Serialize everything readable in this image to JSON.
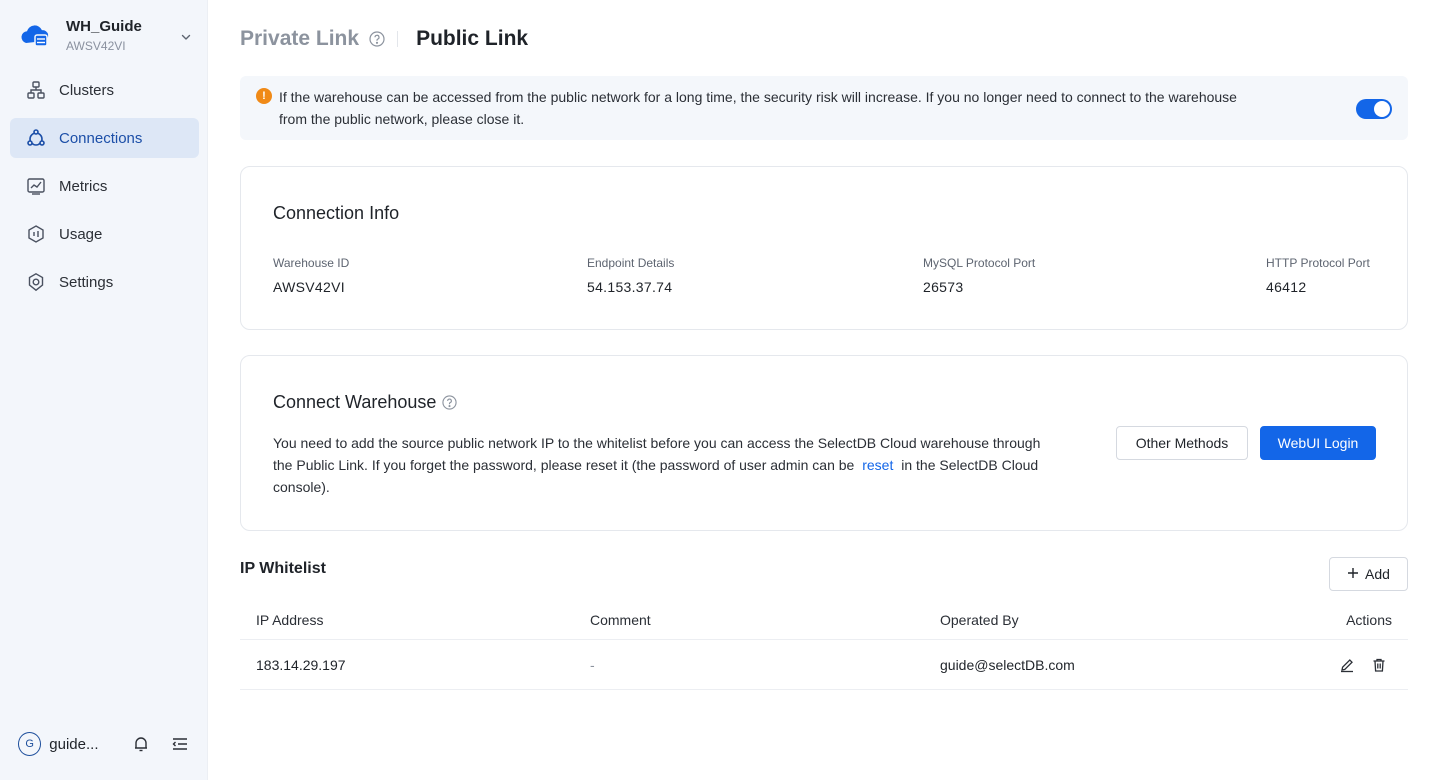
{
  "workspace": {
    "name": "WH_Guide",
    "id": "AWSV42VI",
    "logo_icon": "cloud-database-icon"
  },
  "sidebar": {
    "items": [
      {
        "label": "Clusters",
        "icon": "cluster-icon",
        "active": false
      },
      {
        "label": "Connections",
        "icon": "connections-icon",
        "active": true
      },
      {
        "label": "Metrics",
        "icon": "metrics-icon",
        "active": false
      },
      {
        "label": "Usage",
        "icon": "usage-icon",
        "active": false
      },
      {
        "label": "Settings",
        "icon": "settings-icon",
        "active": false
      }
    ],
    "footer": {
      "avatar_letter": "G",
      "user_name": "guide..."
    }
  },
  "tabs": {
    "private": "Private Link",
    "public": "Public Link"
  },
  "alert": {
    "icon_text": "!",
    "text": "If the warehouse can be accessed from the public network for a long time, the security risk will increase. If you no longer need to connect to the warehouse from the public network, please close it.",
    "toggle_on": true
  },
  "connection_info": {
    "title": "Connection Info",
    "fields": [
      {
        "label": "Warehouse ID",
        "value": "AWSV42VI"
      },
      {
        "label": "Endpoint Details",
        "value": "54.153.37.74"
      },
      {
        "label": "MySQL Protocol Port",
        "value": "26573"
      },
      {
        "label": "HTTP Protocol Port",
        "value": "46412"
      }
    ]
  },
  "connect_warehouse": {
    "title": "Connect Warehouse",
    "text_before": "You need to add the source public network IP to the whitelist before you can access the SelectDB Cloud warehouse through the Public Link. If you forget the password, please reset it (the password of user admin can be",
    "link_text": "reset",
    "text_after": "in the SelectDB Cloud console).",
    "other_methods": "Other Methods",
    "webui_login": "WebUI Login"
  },
  "whitelist": {
    "title": "IP Whitelist",
    "add_label": "Add",
    "columns": [
      "IP Address",
      "Comment",
      "Operated By",
      "Actions"
    ],
    "rows": [
      {
        "ip": "183.14.29.197",
        "comment": "-",
        "operated_by": "guide@selectDB.com"
      }
    ]
  },
  "colors": {
    "primary": "#1366e8",
    "active_nav_bg": "#dde7f6",
    "sidebar_bg": "#f3f6fb",
    "warning": "#f08a17"
  }
}
